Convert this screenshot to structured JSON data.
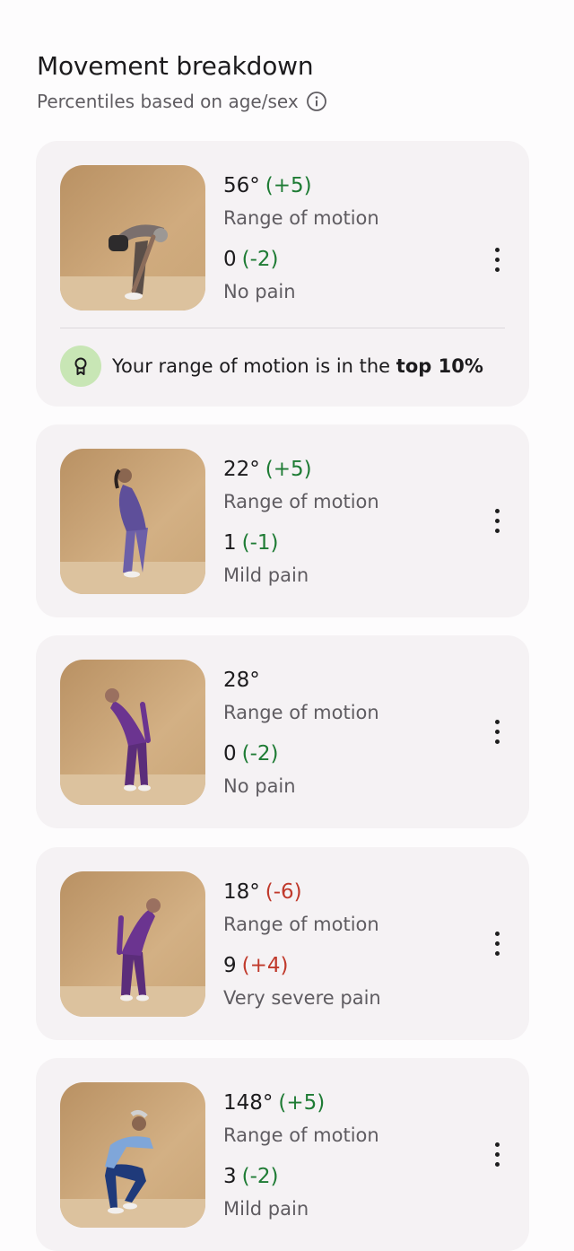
{
  "section": {
    "title": "Movement breakdown",
    "subtitle": "Percentiles based on age/sex",
    "info_icon": "info-icon"
  },
  "colors": {
    "delta_good": "#1e7b34",
    "delta_bad": "#c0392b",
    "card_bg": "#f5f2f4",
    "badge_bg": "#c8e6b5"
  },
  "movements": [
    {
      "rom_value": "56°",
      "rom_delta": "(+5)",
      "rom_delta_tone": "good",
      "rom_label": "Range of motion",
      "pain_value": "0",
      "pain_delta": "(-2)",
      "pain_delta_tone": "good",
      "pain_label": "No pain",
      "image": "forward-bend-photo",
      "badge": {
        "text": "Your range of motion is in the ",
        "strong": "top 10%",
        "icon": "award-ribbon-icon"
      }
    },
    {
      "rom_value": "22°",
      "rom_delta": "(+5)",
      "rom_delta_tone": "good",
      "rom_label": "Range of motion",
      "pain_value": "1",
      "pain_delta": "(-1)",
      "pain_delta_tone": "good",
      "pain_label": "Mild pain",
      "image": "back-bend-photo"
    },
    {
      "rom_value": "28°",
      "rom_delta": "",
      "rom_delta_tone": "",
      "rom_label": "Range of motion",
      "pain_value": "0",
      "pain_delta": "(-2)",
      "pain_delta_tone": "good",
      "pain_label": "No pain",
      "image": "side-bend-right-photo"
    },
    {
      "rom_value": "18°",
      "rom_delta": "(-6)",
      "rom_delta_tone": "bad",
      "rom_label": "Range of motion",
      "pain_value": "9",
      "pain_delta": "(+4)",
      "pain_delta_tone": "bad",
      "pain_label": "Very severe pain",
      "image": "side-bend-left-photo"
    },
    {
      "rom_value": "148°",
      "rom_delta": "(+5)",
      "rom_delta_tone": "good",
      "rom_label": "Range of motion",
      "pain_value": "3",
      "pain_delta": "(-2)",
      "pain_delta_tone": "good",
      "pain_label": "Mild pain",
      "image": "squat-photo"
    }
  ]
}
